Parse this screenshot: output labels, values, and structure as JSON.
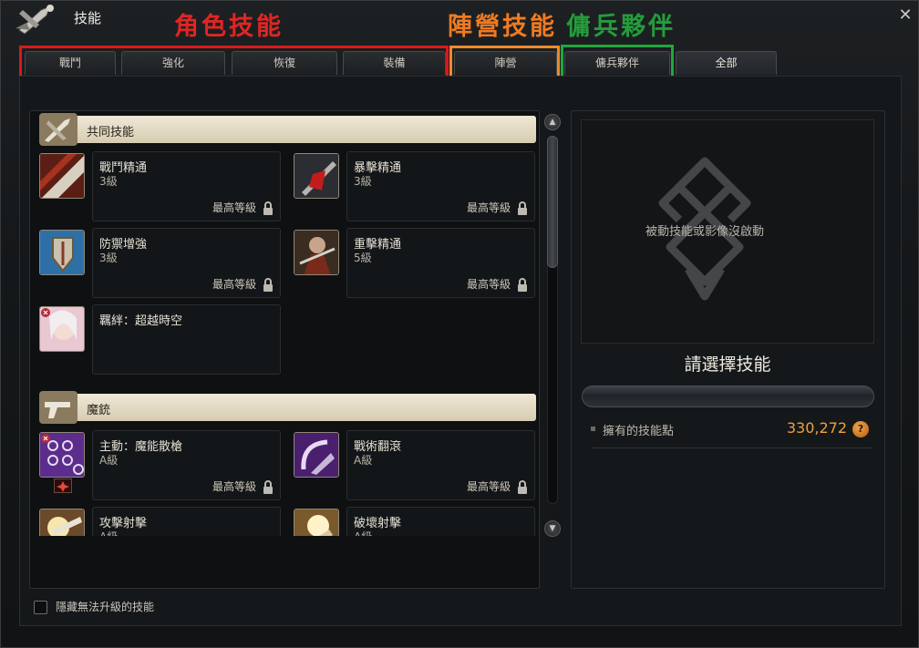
{
  "window": {
    "title": "技能",
    "close_symbol": "✕"
  },
  "annotations": {
    "character_skills": "角色技能",
    "faction_skills": "陣營技能",
    "mercenary": "傭兵夥伴"
  },
  "tabs": [
    {
      "label": "戰鬥"
    },
    {
      "label": "強化"
    },
    {
      "label": "恢復"
    },
    {
      "label": "裝備"
    },
    {
      "label": "陣營"
    },
    {
      "label": "傭兵夥伴"
    },
    {
      "label": "全部"
    }
  ],
  "categories": [
    {
      "title": "共同技能",
      "skills": [
        {
          "name": "戰鬥精通",
          "level": "3級",
          "max": "最高等級"
        },
        {
          "name": "暴擊精通",
          "level": "3級",
          "max": "最高等級"
        },
        {
          "name": "防禦增強",
          "level": "3級",
          "max": "最高等級"
        },
        {
          "name": "重擊精通",
          "level": "5級",
          "max": "最高等級"
        },
        {
          "name": "羈絆：超越時空"
        }
      ]
    },
    {
      "title": "魔銃",
      "skills": [
        {
          "name": "主動：魔能散槍",
          "level": "A級",
          "max": "最高等級"
        },
        {
          "name": "戰術翻滾",
          "level": "A級",
          "max": "最高等級"
        },
        {
          "name": "攻擊射擊",
          "level": "A級"
        },
        {
          "name": "破壞射擊",
          "level": "A級"
        }
      ]
    }
  ],
  "detail": {
    "preview_text": "被動技能或影像沒啟動",
    "prompt": "請選擇技能",
    "points_label": "擁有的技能點",
    "points_value": "330,272",
    "points_coin_symbol": "?"
  },
  "footer": {
    "hide_label": "隱藏無法升級的技能"
  },
  "colors": {
    "highlight_red": "#d9191c",
    "highlight_orange": "#ee8a2c",
    "highlight_green": "#1faa3c",
    "points_orange": "#f0a03a"
  },
  "icons": [
    "crossed-swords-icon",
    "close-icon",
    "lock-icon",
    "scroll-up-icon",
    "scroll-down-icon",
    "knot-emblem-icon",
    "skill-point-coin-icon"
  ]
}
